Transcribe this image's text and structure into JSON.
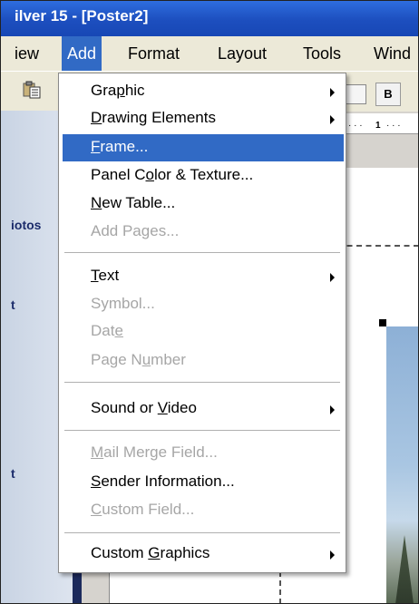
{
  "window": {
    "title": "ilver 15 - [Poster2]"
  },
  "menubar": {
    "items": [
      {
        "label": "iew",
        "active": false
      },
      {
        "label": "Add",
        "active": true
      },
      {
        "label": "Format",
        "active": false
      },
      {
        "label": "Layout",
        "active": false
      },
      {
        "label": "Tools",
        "active": false
      },
      {
        "label": "Wind",
        "active": false
      }
    ]
  },
  "toolbar": {
    "bold_label": "B",
    "paste_icon": "paste-icon"
  },
  "ruler": {
    "label": "1"
  },
  "left_pane": {
    "label_1": "iotos",
    "label_2": "t",
    "label_3": "t"
  },
  "add_menu": {
    "items": [
      {
        "label": "Graphic",
        "submenu": true,
        "disabled": false,
        "highlighted": false
      },
      {
        "label": "Drawing Elements",
        "submenu": true,
        "disabled": false,
        "highlighted": false
      },
      {
        "label": "Frame...",
        "submenu": false,
        "disabled": false,
        "highlighted": true
      },
      {
        "label": "Panel Color & Texture...",
        "submenu": false,
        "disabled": false,
        "highlighted": false
      },
      {
        "label": "New Table...",
        "submenu": false,
        "disabled": false,
        "highlighted": false
      },
      {
        "label": "Add Pages...",
        "submenu": false,
        "disabled": true,
        "highlighted": false
      },
      {
        "label": "Text",
        "submenu": true,
        "disabled": false,
        "highlighted": false
      },
      {
        "label": "Symbol...",
        "submenu": false,
        "disabled": true,
        "highlighted": false
      },
      {
        "label": "Date",
        "submenu": false,
        "disabled": true,
        "highlighted": false
      },
      {
        "label": "Page Number",
        "submenu": false,
        "disabled": true,
        "highlighted": false
      },
      {
        "label": "Sound or Video",
        "submenu": true,
        "disabled": false,
        "highlighted": false
      },
      {
        "label": "Mail Merge Field...",
        "submenu": false,
        "disabled": true,
        "highlighted": false
      },
      {
        "label": "Sender Information...",
        "submenu": false,
        "disabled": false,
        "highlighted": false
      },
      {
        "label": "Custom Field...",
        "submenu": false,
        "disabled": true,
        "highlighted": false
      },
      {
        "label": "Custom Graphics",
        "submenu": true,
        "disabled": false,
        "highlighted": false
      }
    ]
  },
  "colors": {
    "highlight": "#316ac5",
    "titlebar": "#1d4fbf",
    "disabled_text": "#a6a6a6"
  }
}
